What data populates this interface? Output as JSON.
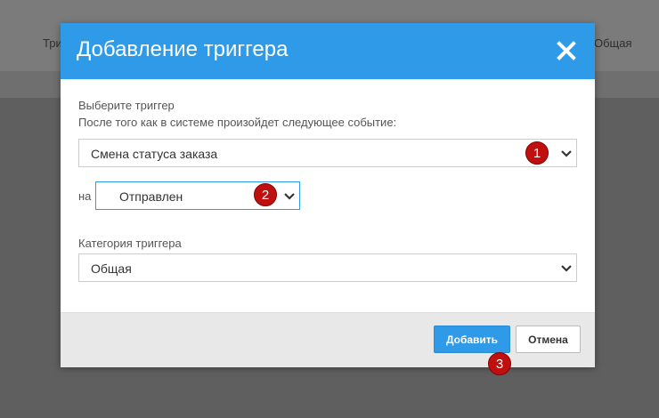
{
  "background": {
    "left_text": "Триг",
    "right_text": "Общая"
  },
  "modal": {
    "title": "Добавление триггера",
    "close_icon": "close-icon",
    "trigger_label": "Выберите триггер",
    "event_label": "После того как в системе произойдет следующее событие:",
    "event_select": {
      "value": "Смена статуса заказа"
    },
    "status_prefix": "на",
    "status_select": {
      "value": "Отправлен"
    },
    "category_label": "Категория триггера",
    "category_select": {
      "value": "Общая"
    },
    "add_label": "Добавить",
    "cancel_label": "Отмена"
  },
  "annotations": [
    "1",
    "2",
    "3"
  ],
  "colors": {
    "header": "#2f9ae8",
    "badge": "#c00f0f",
    "overlay": "#5f5f5f"
  }
}
